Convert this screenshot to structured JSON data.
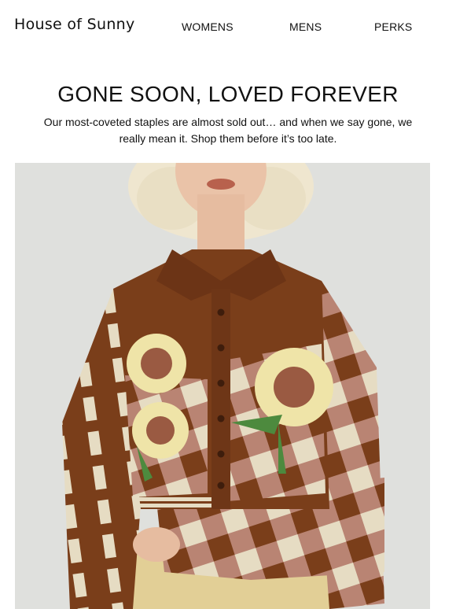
{
  "header": {
    "logo": "House of Sunny",
    "nav": [
      {
        "label": "WOMENS"
      },
      {
        "label": "MENS"
      },
      {
        "label": "PERKS"
      }
    ]
  },
  "hero": {
    "headline": "GONE SOON, LOVED FOREVER",
    "subtext": "Our most-coveted staples are almost sold out… and when we say gone, we really mean it. Shop them before it’s too late."
  },
  "colors": {
    "background": "#ffffff",
    "text": "#111111",
    "cardigan_brown": "#7a3e1a",
    "check_pink": "#b98473",
    "check_cream": "#e6dcc3",
    "sunflower_yellow": "#efe4a8",
    "skirt_beige": "#e2cf96"
  }
}
